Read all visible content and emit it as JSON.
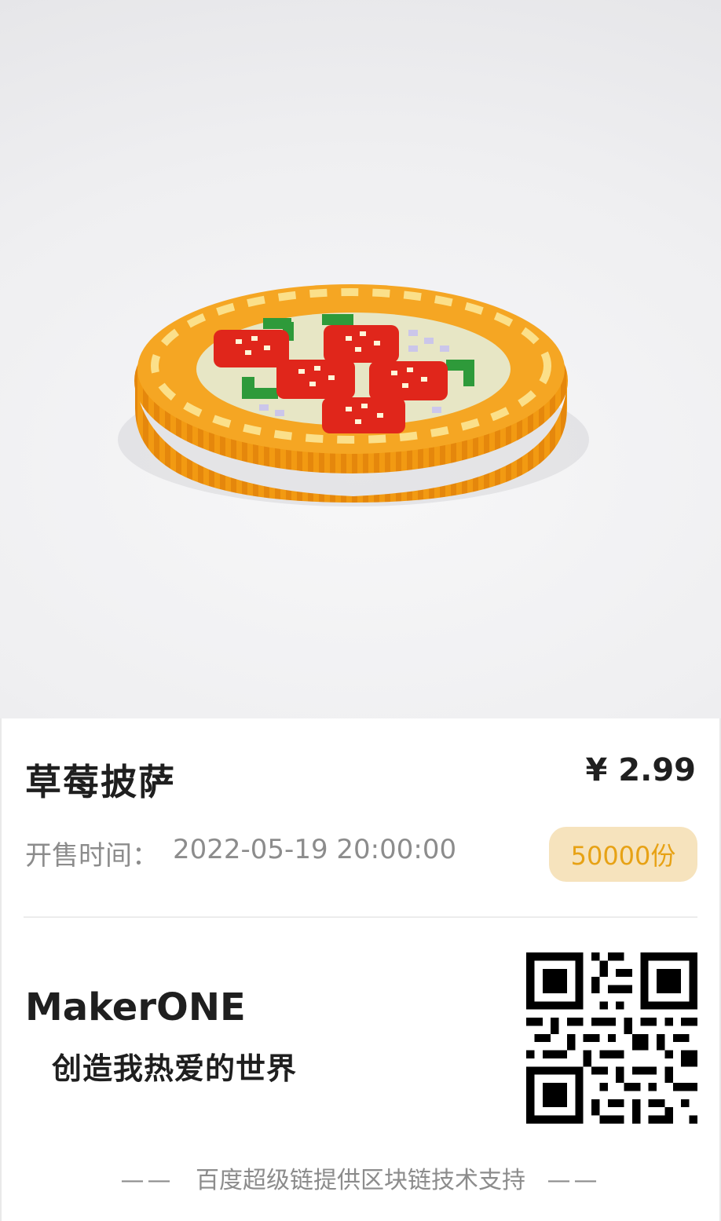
{
  "product": {
    "title": "草莓披萨",
    "price": "¥ 2.99",
    "sale_label": "开售时间：",
    "sale_time": "2022-05-19 20:00:00",
    "quantity": "50000份"
  },
  "brand": {
    "name": "MakerONE",
    "slogan": "创造我热爱的世界"
  },
  "footer": {
    "dash_left": "——",
    "text": "百度超级链提供区块链技术支持",
    "dash_right": "——"
  },
  "colors": {
    "badge_bg": "#f6e3bd",
    "badge_text": "#e7a215",
    "crust": "#f29a12",
    "strawberry": "#e0261b",
    "leaf": "#2e9a3a"
  },
  "images": {
    "hero": "voxel-strawberry-pizza",
    "qr": "qr-code"
  }
}
